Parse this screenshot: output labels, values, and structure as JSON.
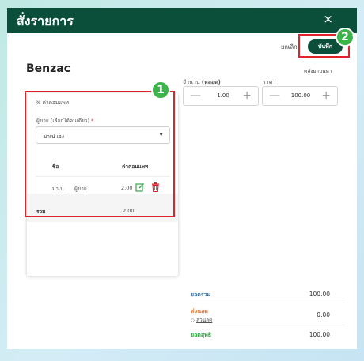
{
  "title": "สั่งรายการ",
  "close_glyph": "×",
  "toolbar": {
    "cancel_label": "ยกเลิก",
    "save_label": "บันทึก"
  },
  "badges": [
    "1",
    "2"
  ],
  "product": {
    "name": "Benzac",
    "references_label": "คลังยาบนหา"
  },
  "quantity": {
    "label_prefix": "จำนวน",
    "label_unit": "(หลอด)",
    "minus": "—",
    "value": "1.00",
    "plus": "+"
  },
  "price": {
    "label": "ราคา",
    "minus": "—",
    "value": "100.00",
    "plus": "+"
  },
  "commission": {
    "header": "ค่าคอมแพท",
    "header_icon": "percent-icon",
    "seller_label": "ผู้ขาย (เลือกได้คนเดียว)",
    "required_mark": "*",
    "seller_value": "มาเน่ เอง",
    "columns": {
      "name": "ชื่อ",
      "commission": "ค่าคอมแพท"
    },
    "rows": [
      {
        "name": "มาเน่",
        "role": "ผู้ขาย",
        "amount": "2.00"
      }
    ],
    "total_label": "รวม",
    "total_value": "2.00"
  },
  "summary": {
    "subtotal_label": "ยอดรวม",
    "subtotal_value": "100.00",
    "discount_label": "ส่วนลด",
    "discount_link": "ส่วนลด",
    "discount_value": "0.00",
    "net_label": "ยอดสุทธิ",
    "net_value": "100.00"
  },
  "colors": {
    "header": "#0b4e3a",
    "annotation_border": "#e0232b",
    "badge": "#3bb54a",
    "discount": "#e8722c",
    "net": "#2f9a3e",
    "subtotal": "#3a6f9c",
    "edit_icon": "#3aa34b",
    "delete_icon": "#e0232b"
  }
}
